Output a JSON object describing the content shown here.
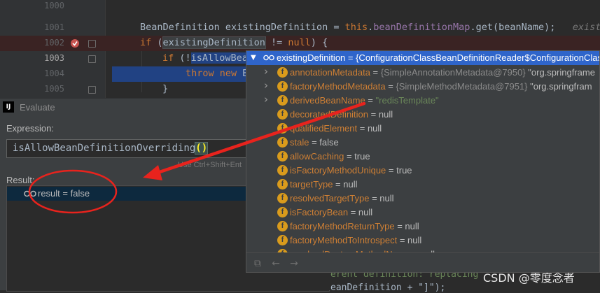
{
  "editor": {
    "lines": [
      {
        "num": "1000",
        "code": ""
      },
      {
        "num": "1001",
        "code_parts": [
          "BeanDefinition existingDefinition = ",
          "this",
          ".",
          "beanDefinitionMap",
          ".get(beanName);   ",
          "exist"
        ]
      },
      {
        "num": "1002",
        "code_parts": [
          "if",
          " (",
          "existingDefinition",
          " != ",
          "null",
          ") {"
        ]
      },
      {
        "num": "1003",
        "code_parts": [
          "if",
          " (!",
          "isAllowBea"
        ]
      },
      {
        "num": "1004",
        "code_parts": [
          "throw new",
          " B"
        ]
      },
      {
        "num": "1005",
        "code_parts": [
          "}"
        ]
      }
    ]
  },
  "evaluate_dialog": {
    "logo_text": "IJ",
    "title": "Evaluate",
    "expression_label": "Expression:",
    "expression": "isAllowBeanDefinitionOverriding",
    "expression_parens": "()",
    "hint": "Use Ctrl+Shift+Ent",
    "result_label": "Result:",
    "result_text": "result = false"
  },
  "popup": {
    "header": "existingDefinition = {ConfigurationClassBeanDefinitionReader$ConfigurationClas",
    "properties": [
      {
        "name": "annotationMetadata",
        "eq": " = ",
        "value_ref": "{SimpleAnnotationMetadata@7950}",
        "value": " \"org.springframe",
        "expandable": true
      },
      {
        "name": "factoryMethodMetadata",
        "eq": " = ",
        "value_ref": "{SimpleMethodMetadata@7951}",
        "value": " \"org.springfram",
        "expandable": true
      },
      {
        "name": "derivedBeanName",
        "eq": " = ",
        "value_str": "\"redisTemplate\"",
        "expandable": true
      },
      {
        "name": "decoratedDefinition",
        "eq": " = ",
        "value": "null",
        "expandable": false
      },
      {
        "name": "qualifiedElement",
        "eq": " = ",
        "value": "null",
        "expandable": false
      },
      {
        "name": "stale",
        "eq": " = ",
        "value": "false",
        "expandable": false
      },
      {
        "name": "allowCaching",
        "eq": " = ",
        "value": "true",
        "expandable": false
      },
      {
        "name": "isFactoryMethodUnique",
        "eq": " = ",
        "value": "true",
        "expandable": false
      },
      {
        "name": "targetType",
        "eq": " = ",
        "value": "null",
        "expandable": false
      },
      {
        "name": "resolvedTargetType",
        "eq": " = ",
        "value": "null",
        "expandable": false
      },
      {
        "name": "isFactoryBean",
        "eq": " = ",
        "value": "null",
        "expandable": false
      },
      {
        "name": "factoryMethodReturnType",
        "eq": " = ",
        "value": "null",
        "expandable": false
      },
      {
        "name": "factoryMethodToIntrospect",
        "eq": " = ",
        "value": "null",
        "expandable": false
      },
      {
        "name": "resolvedDestroyMethodName",
        "eq": " = ",
        "value": "null",
        "expandable": false
      }
    ],
    "field_icon_letter": "f"
  },
  "background_code": {
    "line1": "erent definition: replacing",
    "line2": "eanDefinition + \"]\");"
  },
  "watermark": "CSDN @零度念者",
  "colors": {
    "annotation_red": "#e8231d",
    "popup_header": "#2f65ca",
    "field_icon": "#d99b1c"
  }
}
